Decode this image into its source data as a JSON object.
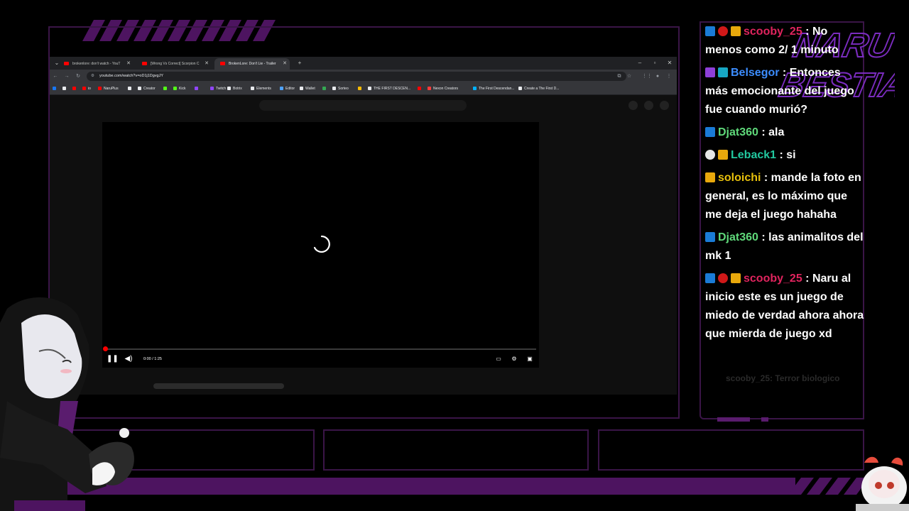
{
  "browser": {
    "tabs": [
      {
        "label": "brokenlore: don't watch - YouT",
        "active": false
      },
      {
        "label": "[Wrong Vs Correct] Scorpion C",
        "active": false
      },
      {
        "label": "BrokenLore: Don't Lie - Trailer",
        "active": true
      }
    ],
    "new_tab": "+",
    "url": "youtube.com/watch?v=oD1j1DgvgJY",
    "bookmarks": [
      {
        "label": "",
        "color": "#1877f2"
      },
      {
        "label": "",
        "color": "#e8eaed"
      },
      {
        "label": "",
        "color": "#ff0000"
      },
      {
        "label": "io",
        "color": "#ff0000"
      },
      {
        "label": "NaruPlus",
        "color": "#ff0000"
      },
      {
        "label": "",
        "color": "#e8eaed"
      },
      {
        "label": "Creator",
        "color": "#e8eaed"
      },
      {
        "label": "",
        "color": "#53fc18"
      },
      {
        "label": "Kick",
        "color": "#53fc18"
      },
      {
        "label": "",
        "color": "#9146ff"
      },
      {
        "label": "Twitch",
        "color": "#9146ff"
      },
      {
        "label": "Botrix",
        "color": "#e8eaed"
      },
      {
        "label": "Elements",
        "color": "#e8eaed"
      },
      {
        "label": "Editor",
        "color": "#4fa3ff"
      },
      {
        "label": "Wallet",
        "color": "#e8eaed"
      },
      {
        "label": "",
        "color": "#34a853"
      },
      {
        "label": "Sorteo",
        "color": "#e8eaed"
      },
      {
        "label": "",
        "color": "#fbbc04"
      },
      {
        "label": "THE FIRST DESCEN...",
        "color": "#e8eaed"
      },
      {
        "label": "",
        "color": "#ff0000"
      },
      {
        "label": "Nexon Creators",
        "color": "#ff3b3b"
      },
      {
        "label": "The First Descendan...",
        "color": "#00b2ff"
      },
      {
        "label": "Create a The First D...",
        "color": "#e8eaed"
      }
    ]
  },
  "player": {
    "time": "0:00 / 1:25",
    "progress_fraction": 0.0
  },
  "chat": {
    "messages": [
      {
        "badges": [
          "b-blue",
          "b-red",
          "b-gold"
        ],
        "user": "scooby_25",
        "color": "#e0245e",
        "text": ": No menos como 2/ 1 minuto"
      },
      {
        "badges": [
          "b-purple",
          "b-teal"
        ],
        "user": "Belsegor",
        "color": "#3c8dff",
        "text": ": Entonces más emocionante del juego fue cuando murió?"
      },
      {
        "badges": [
          "b-blue"
        ],
        "user": "Djat360",
        "color": "#5fd97a",
        "text": ": ala"
      },
      {
        "badges": [
          "b-white",
          "b-gold"
        ],
        "user": "Leback1",
        "color": "#22c9a0",
        "text": ": si"
      },
      {
        "badges": [
          "b-gold"
        ],
        "user": "soloichi",
        "color": "#e8c10c",
        "text": ": mande la foto en general, es lo máximo que me deja el juego hahaha"
      },
      {
        "badges": [
          "b-blue"
        ],
        "user": "Djat360",
        "color": "#5fd97a",
        "text": ": las animalitos del mk 1"
      },
      {
        "badges": [
          "b-blue",
          "b-red",
          "b-gold"
        ],
        "user": "scooby_25",
        "color": "#e0245e",
        "text": ": Naru al inicio este es un juego de miedo de verdad ahora ahora que mierda de juego xd"
      }
    ],
    "faded": {
      "user": "scooby_25",
      "text": ": Terror biologico"
    }
  },
  "logo": {
    "line1": "NARU",
    "line2": "BESTIA"
  },
  "colors": {
    "accent": "#4d1460",
    "frame": "#3a1547",
    "logo": "#7b2cbf"
  }
}
